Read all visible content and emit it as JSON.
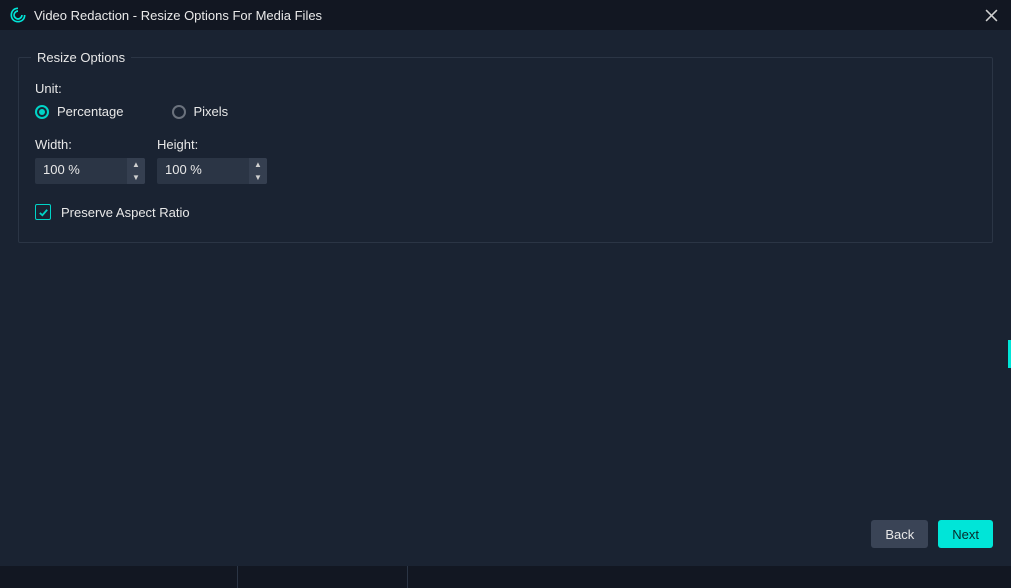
{
  "titlebar": {
    "title": "Video Redaction - Resize Options For Media Files"
  },
  "group": {
    "legend": "Resize Options",
    "unit_label": "Unit:",
    "radios": {
      "percentage": "Percentage",
      "pixels": "Pixels",
      "selected": "percentage"
    },
    "width": {
      "label": "Width:",
      "value": "100 %"
    },
    "height": {
      "label": "Height:",
      "value": "100 %"
    },
    "preserve_label": "Preserve Aspect Ratio",
    "preserve_checked": true
  },
  "footer": {
    "back": "Back",
    "next": "Next"
  },
  "colors": {
    "accent": "#00e5d8",
    "bg": "#1a2332",
    "panel_border": "#2b3545"
  }
}
